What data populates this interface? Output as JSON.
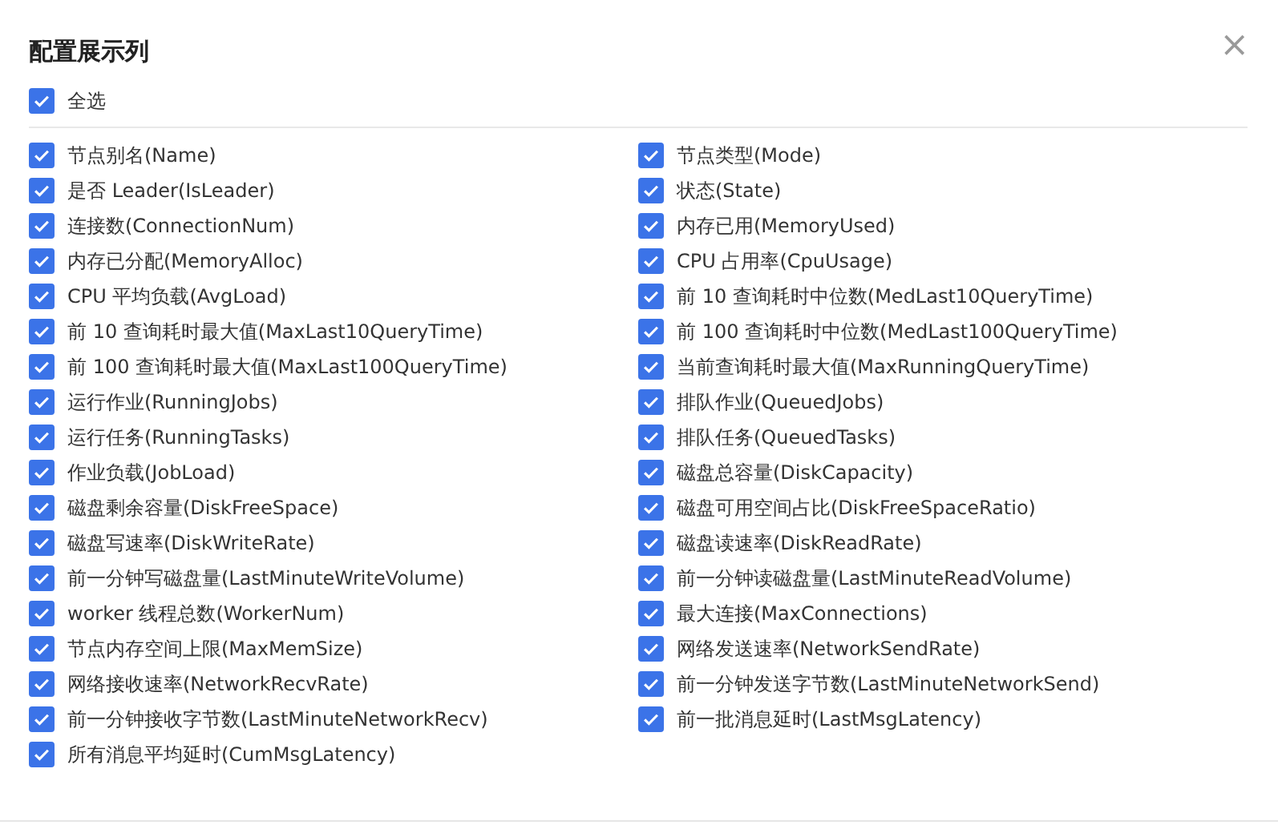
{
  "dialog": {
    "title": "配置展示列",
    "close": "×"
  },
  "select_all": {
    "label": "全选",
    "checked": true
  },
  "options": [
    {
      "label": "节点别名(Name)",
      "checked": true
    },
    {
      "label": "节点类型(Mode)",
      "checked": true
    },
    {
      "label": "是否 Leader(IsLeader)",
      "checked": true
    },
    {
      "label": "状态(State)",
      "checked": true
    },
    {
      "label": "连接数(ConnectionNum)",
      "checked": true
    },
    {
      "label": "内存已用(MemoryUsed)",
      "checked": true
    },
    {
      "label": "内存已分配(MemoryAlloc)",
      "checked": true
    },
    {
      "label": "CPU 占用率(CpuUsage)",
      "checked": true
    },
    {
      "label": "CPU 平均负载(AvgLoad)",
      "checked": true
    },
    {
      "label": "前 10 查询耗时中位数(MedLast10QueryTime)",
      "checked": true
    },
    {
      "label": "前 10 查询耗时最大值(MaxLast10QueryTime)",
      "checked": true
    },
    {
      "label": "前 100 查询耗时中位数(MedLast100QueryTime)",
      "checked": true
    },
    {
      "label": "前 100 查询耗时最大值(MaxLast100QueryTime)",
      "checked": true
    },
    {
      "label": "当前查询耗时最大值(MaxRunningQueryTime)",
      "checked": true
    },
    {
      "label": "运行作业(RunningJobs)",
      "checked": true
    },
    {
      "label": "排队作业(QueuedJobs)",
      "checked": true
    },
    {
      "label": "运行任务(RunningTasks)",
      "checked": true
    },
    {
      "label": "排队任务(QueuedTasks)",
      "checked": true
    },
    {
      "label": "作业负载(JobLoad)",
      "checked": true
    },
    {
      "label": "磁盘总容量(DiskCapacity)",
      "checked": true
    },
    {
      "label": "磁盘剩余容量(DiskFreeSpace)",
      "checked": true
    },
    {
      "label": "磁盘可用空间占比(DiskFreeSpaceRatio)",
      "checked": true
    },
    {
      "label": "磁盘写速率(DiskWriteRate)",
      "checked": true
    },
    {
      "label": "磁盘读速率(DiskReadRate)",
      "checked": true
    },
    {
      "label": "前一分钟写磁盘量(LastMinuteWriteVolume)",
      "checked": true
    },
    {
      "label": "前一分钟读磁盘量(LastMinuteReadVolume)",
      "checked": true
    },
    {
      "label": "worker 线程总数(WorkerNum)",
      "checked": true
    },
    {
      "label": "最大连接(MaxConnections)",
      "checked": true
    },
    {
      "label": "节点内存空间上限(MaxMemSize)",
      "checked": true
    },
    {
      "label": "网络发送速率(NetworkSendRate)",
      "checked": true
    },
    {
      "label": "网络接收速率(NetworkRecvRate)",
      "checked": true
    },
    {
      "label": "前一分钟发送字节数(LastMinuteNetworkSend)",
      "checked": true
    },
    {
      "label": "前一分钟接收字节数(LastMinuteNetworkRecv)",
      "checked": true
    },
    {
      "label": "前一批消息延时(LastMsgLatency)",
      "checked": true
    },
    {
      "label": "所有消息平均延时(CumMsgLatency)",
      "checked": true
    }
  ]
}
